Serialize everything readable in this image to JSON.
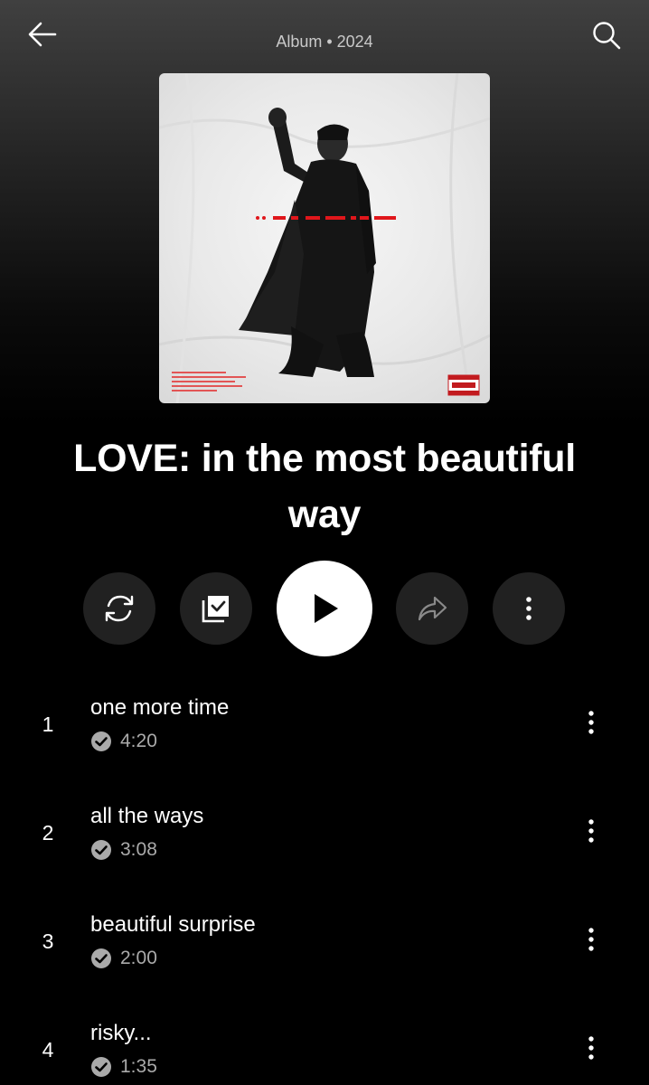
{
  "header": {
    "subtitle": "Album • 2024",
    "back_icon": "arrow-left-icon",
    "search_icon": "search-icon"
  },
  "album": {
    "title": "LOVE: in the most beautiful way",
    "cover_label": "PARENTAL ADVISORY EXPLICIT CONTENT"
  },
  "actions": [
    {
      "name": "sync",
      "icon": "sync-icon"
    },
    {
      "name": "save-to-library",
      "icon": "library-check-icon"
    },
    {
      "name": "play",
      "icon": "play-icon"
    },
    {
      "name": "share",
      "icon": "share-icon"
    },
    {
      "name": "more",
      "icon": "more-vertical-icon"
    }
  ],
  "tracks": [
    {
      "number": "1",
      "title": "one more time",
      "duration": "4:20"
    },
    {
      "number": "2",
      "title": "all the ways",
      "duration": "3:08"
    },
    {
      "number": "3",
      "title": "beautiful surprise",
      "duration": "2:00"
    },
    {
      "number": "4",
      "title": "risky...",
      "duration": "1:35"
    }
  ],
  "colors": {
    "background": "#000000",
    "button_bg": "#212121",
    "play_bg": "#ffffff",
    "secondary_text": "#aaaaaa",
    "cover_accent": "#e0161b"
  }
}
